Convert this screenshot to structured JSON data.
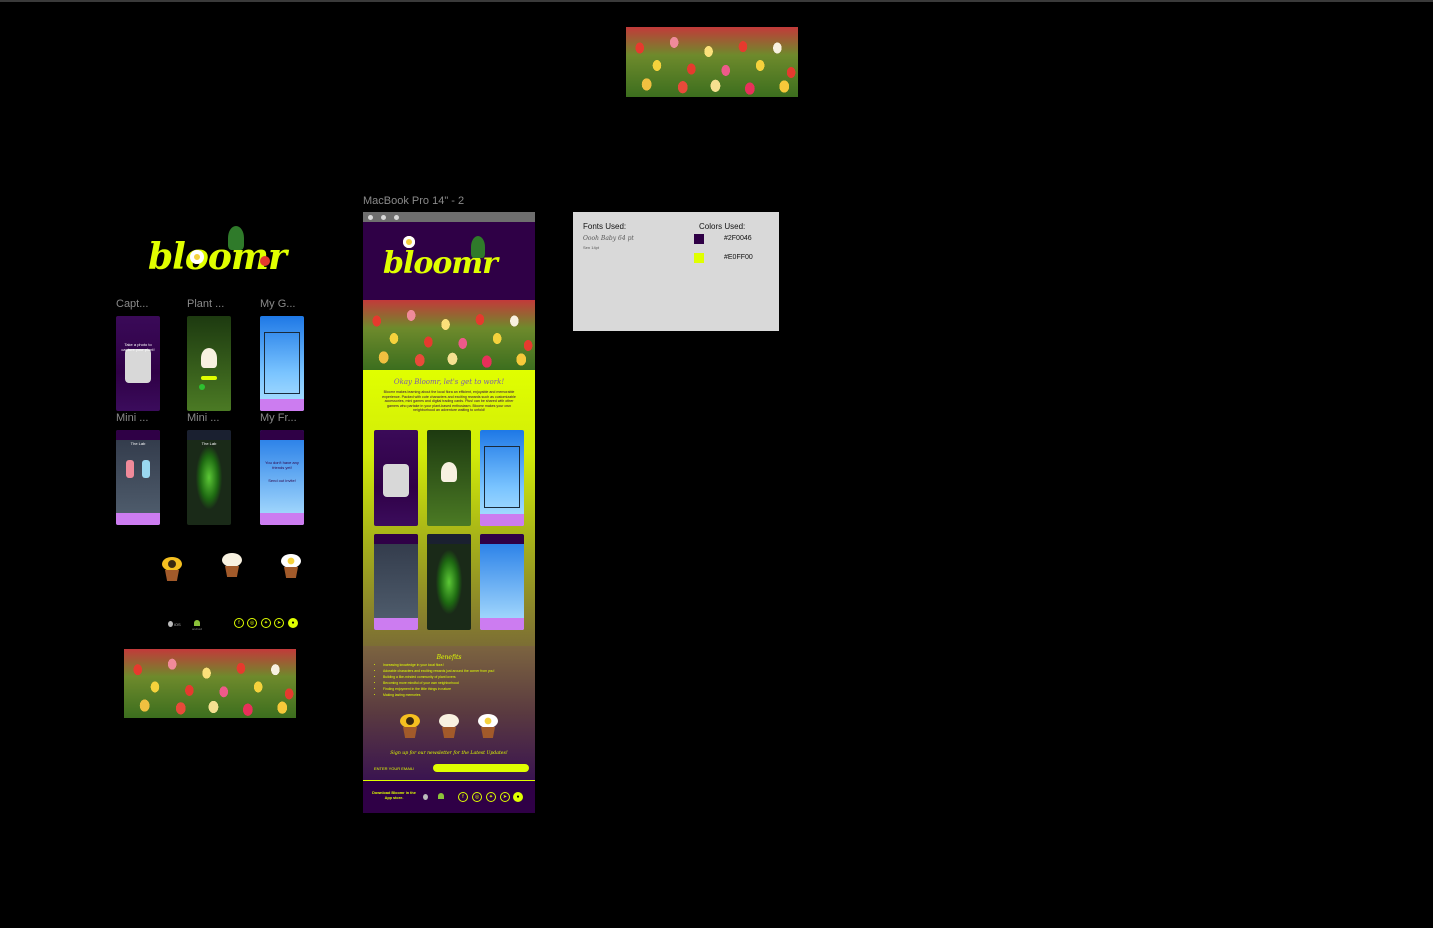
{
  "canvas": {
    "frame_label": "MacBook Pro 14\" - 2"
  },
  "brand": {
    "logo_text": "bloomr",
    "primary_color": "#2F0046",
    "accent_color": "#E0FF00"
  },
  "thumbnails": [
    {
      "label": "Capt..."
    },
    {
      "label": "Plant ..."
    },
    {
      "label": "My G..."
    },
    {
      "label": "Mini ..."
    },
    {
      "label": "Mini ..."
    },
    {
      "label": "My Fr..."
    }
  ],
  "screens": {
    "capture_text": "Take a photo to capture your plant!",
    "lab_title": "The Lab",
    "friends_text": "You don't have any friends yet!",
    "friends_cta": "Send out invite!"
  },
  "landing": {
    "intro_heading": "Okay Bloomr, let's get to work!",
    "intro_body": "Bloomr makes learning about the local flora an efficient, enjoyable and memorable experience. Packed with cute characters and exciting rewards such as customizable accessories, mini games and digital trading cards. Plus! can be shared with other gamers who partake in your plant-based enthusiasm. Bloomr makes your own neighborhood an adventure waiting to unfold!",
    "benefits_heading": "Benefits",
    "benefits": [
      "Increasing knowledge in your local flora !",
      "Adorable characters and exciting rewards just around the corner from you!",
      "Building a like-minded community of plant lovers",
      "Becoming more mindful of your own neighborhood",
      "Finding enjoyment in the little things in nature",
      "Making lasting memories"
    ],
    "newsletter_heading": "Sign up for our newsletter for the Latest Updates!",
    "email_label": "ENTER YOUR EMAIL!",
    "download_text": "Download Bloomr in the App store."
  },
  "footer_small": {
    "ios": "iOS",
    "android": "android"
  },
  "style_card": {
    "fonts_heading": "Fonts Used:",
    "font_1": "Oooh Baby 64 pt",
    "font_2": "Sen 14pt",
    "colors_heading": "Colors Used:",
    "colors": [
      {
        "hex": "#2F0046"
      },
      {
        "hex": "#E0FF00"
      }
    ]
  },
  "icons": [
    "apple-icon",
    "android-icon",
    "facebook-icon",
    "instagram-icon",
    "twitter-icon",
    "telegram-icon",
    "discord-icon"
  ]
}
